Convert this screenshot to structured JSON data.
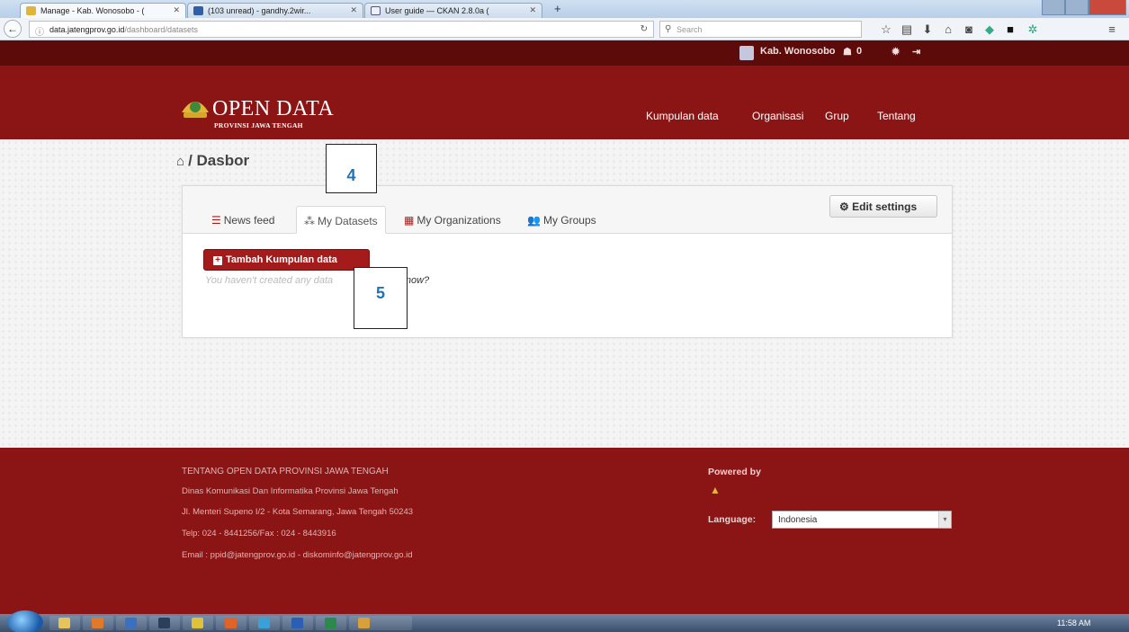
{
  "browser": {
    "tabs": [
      {
        "title": "Manage - Kab. Wonosobo - (",
        "active": true
      },
      {
        "title": "(103 unread) - gandhy.2wir...",
        "active": false
      },
      {
        "title": "User guide — CKAN 2.8.0a (",
        "active": false
      }
    ],
    "new_tab": "+",
    "url_host": "data.jatengprov.go.id",
    "url_path": "/dashboard/datasets",
    "search_placeholder": "Search"
  },
  "site": {
    "account_name": "Kab. Wonosobo",
    "follow_count": "0",
    "logo_title": "OPEN DATA",
    "logo_subtitle": "PROVINSI JAWA TENGAH",
    "nav": [
      "Kumpulan data",
      "Organisasi",
      "Grup",
      "Tentang"
    ]
  },
  "page": {
    "breadcrumb": "/ Dasbor",
    "tabs": [
      "News feed",
      "My Datasets",
      "My Organizations",
      "My Groups"
    ],
    "active_tab": "My Datasets",
    "edit_settings": "Edit settings",
    "add_dataset": "Tambah Kumpulan data",
    "empty_text": "You haven't created any data",
    "empty_link": "te one now?",
    "annotations": [
      "4",
      "5"
    ]
  },
  "footer": {
    "title": "TENTANG OPEN DATA PROVINSI JAWA TENGAH",
    "lines": [
      "Dinas Komunikasi Dan Informatika Provinsi Jawa Tengah",
      "Jl. Menteri Supeno I/2 - Kota Semarang, Jawa Tengah 50243",
      "Telp: 024 - 8441256/Fax : 024 - 8443916",
      "Email : ppid@jatengprov.go.id - diskominfo@jatengprov.go.id"
    ],
    "powered_by": "Powered by",
    "language_label": "Language:",
    "language_value": "Indonesia"
  },
  "taskbar": {
    "clock": "11:58 AM"
  },
  "colors": {
    "brand_red": "#8b1515",
    "dark_red": "#5c0a0a",
    "button_red": "#a31b1b",
    "annotation_blue": "#1f73b7"
  }
}
